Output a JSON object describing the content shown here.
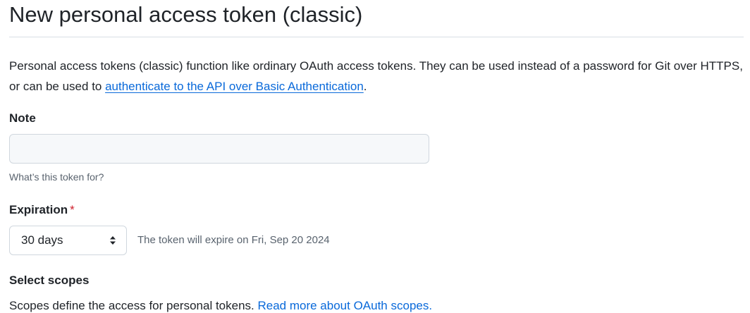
{
  "header": {
    "title": "New personal access token (classic)"
  },
  "intro": {
    "text_before_link": "Personal access tokens (classic) function like ordinary OAuth access tokens. They can be used instead of a password for Git over HTTPS, or can be used to ",
    "link_text": "authenticate to the API over Basic Authentication",
    "text_after_link": "."
  },
  "note": {
    "label": "Note",
    "value": "",
    "placeholder": "",
    "hint": "What’s this token for?"
  },
  "expiration": {
    "label": "Expiration",
    "required_marker": "*",
    "selected": "30 days",
    "expiry_message": "The token will expire on Fri, Sep 20 2024",
    "icon": "select-arrows-icon"
  },
  "scopes": {
    "label": "Select scopes",
    "description": "Scopes define the access for personal tokens. ",
    "link_text": "Read more about OAuth scopes."
  },
  "colors": {
    "link": "#0969da",
    "required": "#cf222e",
    "muted_text": "#59636e",
    "border": "#d0d7de",
    "input_bg": "#f6f8fa"
  }
}
